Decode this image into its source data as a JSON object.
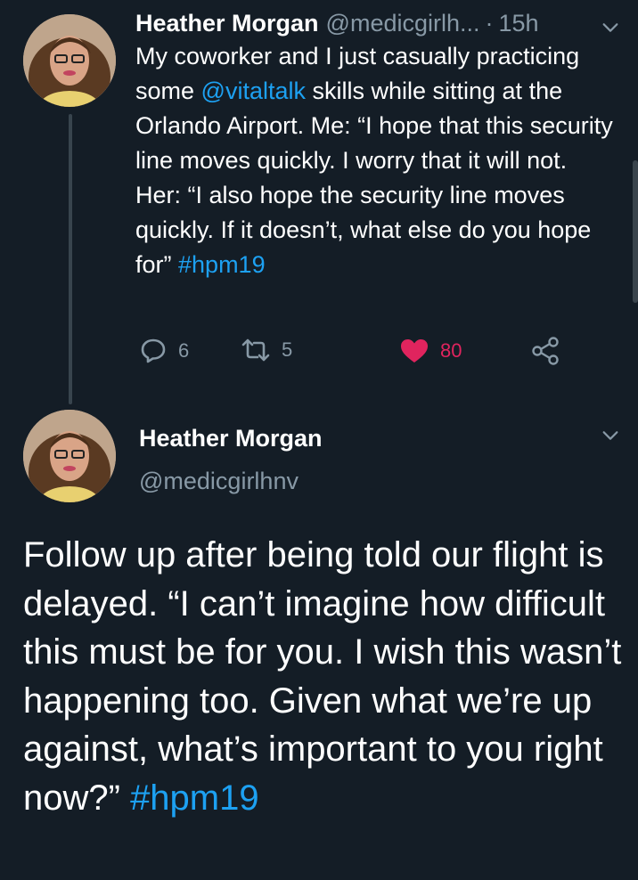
{
  "tweet1": {
    "name": "Heather Morgan",
    "handle": "@medicgirlh...",
    "time": "15h",
    "text_parts": [
      {
        "text": "My coworker and I just casually practicing some ",
        "link": false
      },
      {
        "text": "@vitaltalk",
        "link": true
      },
      {
        "text": " skills while sitting at the Orlando Airport. Me: “I hope that this security line moves quickly. I worry that it will not. Her: “I also hope the security line moves quickly. If it doesn’t, what else do you hope for” ",
        "link": false
      },
      {
        "text": "#hpm19",
        "link": true
      }
    ],
    "replies": "6",
    "retweets": "5",
    "likes": "80"
  },
  "tweet2": {
    "name": "Heather Morgan",
    "handle": "@medicgirlhnv",
    "text_parts": [
      {
        "text": "Follow up after being told our flight is delayed. “I can’t imagine how difficult this must be for you. I wish this wasn’t happening too. Given what we’re up against, what’s important to you right now?” ",
        "link": false
      },
      {
        "text": "#hpm19",
        "link": true
      }
    ]
  },
  "icons": {
    "reply": "reply-icon",
    "retweet": "retweet-icon",
    "like": "heart-icon",
    "share": "share-icon",
    "caret": "chevron-down-icon"
  },
  "colors": {
    "background": "#141d26",
    "link": "#1da1f2",
    "secondary": "#8899a6",
    "like": "#e0245e"
  }
}
